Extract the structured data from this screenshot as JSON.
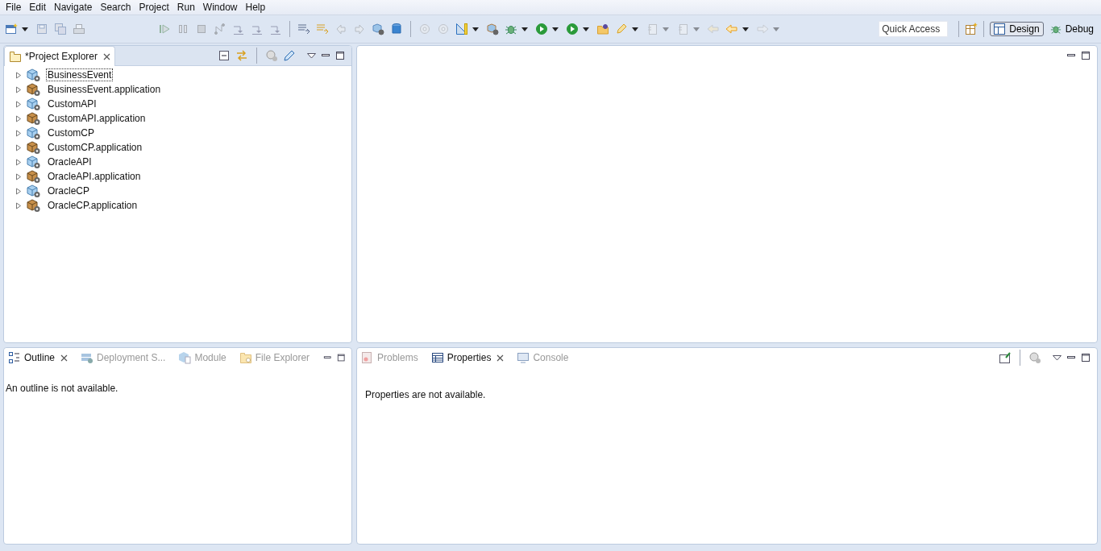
{
  "menu": [
    "File",
    "Edit",
    "Navigate",
    "Search",
    "Project",
    "Run",
    "Window",
    "Help"
  ],
  "toolbar": [
    [
      {
        "disabled": false,
        "dropdown": true
      },
      {
        "disabled": true,
        "dropdown": false
      },
      {
        "disabled": true,
        "dropdown": false
      },
      {
        "disabled": true,
        "dropdown": false
      }
    ],
    [
      {
        "disabled": true,
        "dropdown": false
      },
      {
        "disabled": true,
        "dropdown": false
      },
      {
        "disabled": true,
        "dropdown": false
      },
      {
        "disabled": true,
        "dropdown": false
      },
      {
        "disabled": true,
        "dropdown": false
      },
      {
        "disabled": true,
        "dropdown": false
      },
      {
        "disabled": true,
        "dropdown": false
      }
    ],
    [
      {
        "disabled": false,
        "dropdown": false
      },
      {
        "disabled": false,
        "dropdown": false
      },
      {
        "disabled": true,
        "dropdown": false
      },
      {
        "disabled": true,
        "dropdown": false
      },
      {
        "disabled": false,
        "dropdown": false
      },
      {
        "disabled": false,
        "dropdown": false
      }
    ],
    [
      {
        "disabled": true,
        "dropdown": false
      },
      {
        "disabled": true,
        "dropdown": false
      },
      {
        "disabled": false,
        "dropdown": true
      },
      {
        "disabled": false,
        "dropdown": false
      },
      {
        "disabled": false,
        "dropdown": true
      },
      {
        "disabled": false,
        "dropdown": true
      },
      {
        "disabled": false,
        "dropdown": true
      },
      {
        "disabled": false,
        "dropdown": false
      },
      {
        "disabled": false,
        "dropdown": true
      },
      {
        "disabled": true,
        "dropdown": true
      },
      {
        "disabled": true,
        "dropdown": true
      },
      {
        "disabled": true,
        "dropdown": false
      },
      {
        "disabled": false,
        "dropdown": true
      },
      {
        "disabled": true,
        "dropdown": true
      }
    ]
  ],
  "quick_access": {
    "placeholder": "Quick Access"
  },
  "perspectives": [
    {
      "label": "Design",
      "selected": true
    },
    {
      "label": "Debug",
      "selected": false
    }
  ],
  "project_explorer": {
    "tab": "*Project Explorer",
    "items": [
      {
        "label": "BusinessEvent",
        "kind": "project",
        "focused": true
      },
      {
        "label": "BusinessEvent.application",
        "kind": "application",
        "focused": false
      },
      {
        "label": "CustomAPI",
        "kind": "project",
        "focused": false
      },
      {
        "label": "CustomAPI.application",
        "kind": "application",
        "focused": false
      },
      {
        "label": "CustomCP",
        "kind": "project",
        "focused": false
      },
      {
        "label": "CustomCP.application",
        "kind": "application",
        "focused": false
      },
      {
        "label": "OracleAPI",
        "kind": "project",
        "focused": false
      },
      {
        "label": "OracleAPI.application",
        "kind": "application",
        "focused": false
      },
      {
        "label": "OracleCP",
        "kind": "project",
        "focused": false
      },
      {
        "label": "OracleCP.application",
        "kind": "application",
        "focused": false
      }
    ]
  },
  "outline_panel": {
    "tabs": [
      {
        "label": "Outline",
        "selected": true
      },
      {
        "label": "Deployment S...",
        "selected": false
      },
      {
        "label": "Module",
        "selected": false
      },
      {
        "label": "File Explorer",
        "selected": false
      }
    ],
    "message": "An outline is not available."
  },
  "properties_panel": {
    "tabs": [
      {
        "label": "Problems",
        "selected": false
      },
      {
        "label": "Properties",
        "selected": true
      },
      {
        "label": "Console",
        "selected": false
      }
    ],
    "message": "Properties are not available."
  }
}
